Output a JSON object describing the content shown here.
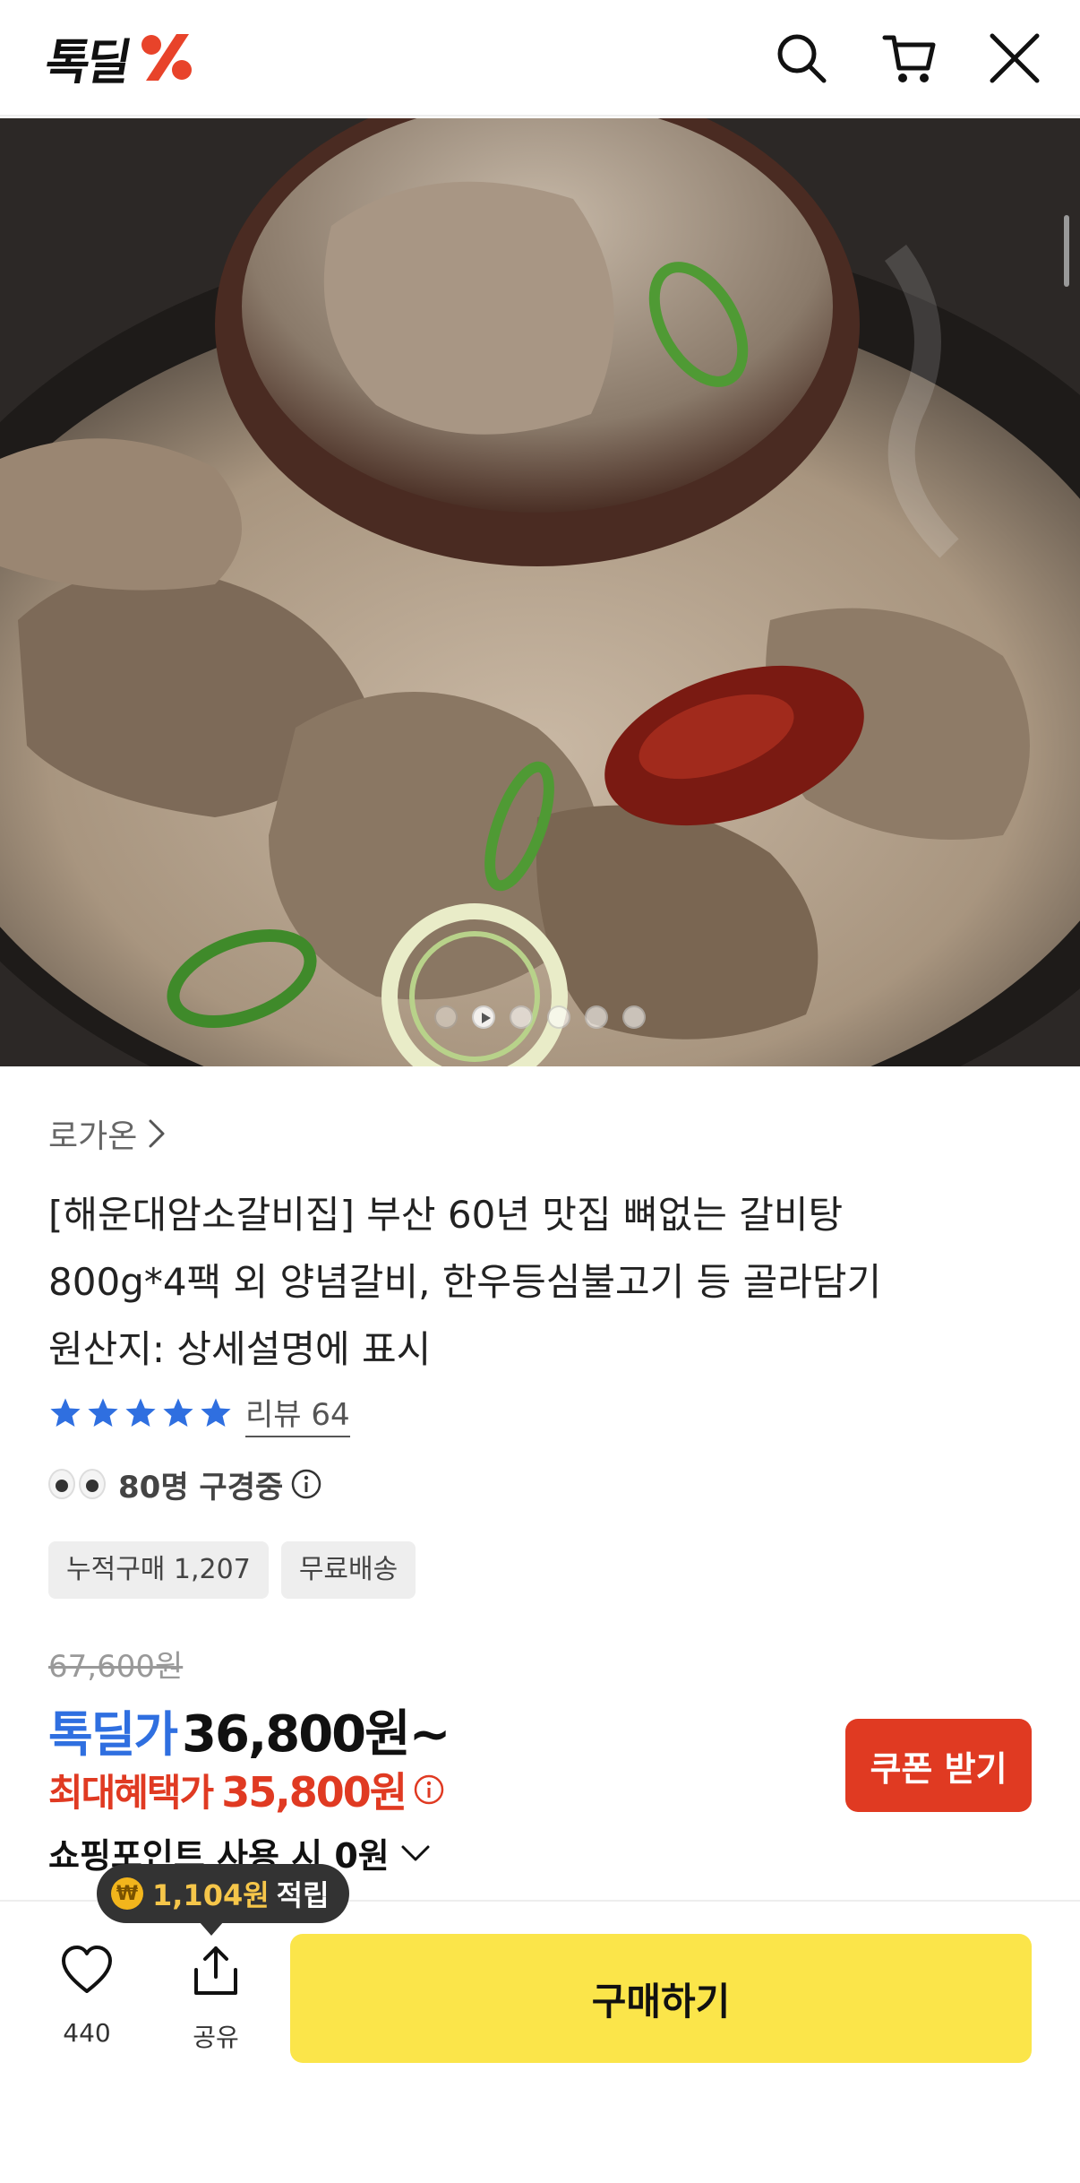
{
  "header": {
    "logo_text": "톡딜",
    "icons": [
      "search-icon",
      "cart-icon",
      "close-icon"
    ]
  },
  "hero": {
    "image_description_icon": "product-photo",
    "carousel_count": 6,
    "carousel_active": 1
  },
  "product": {
    "seller": "로가온",
    "title_lines": [
      "[해운대암소갈비집] 부산 60년 맛집 뼈없는 갈비탕",
      "800g*4팩 외 양념갈비, 한우등심불고기 등 골라담기",
      "원산지: 상세설명에 표시"
    ],
    "review_label": "리뷰 64",
    "rating_stars": 5,
    "viewers_text": "80명 구경중",
    "badges": [
      "누적구매 1,207",
      "무료배송"
    ],
    "original_price": "67,600원",
    "deal_label": "톡딜가",
    "deal_price": "36,800원~",
    "max_label": "최대혜택가",
    "max_price": "35,800원",
    "point_text": "쇼핑포인트 사용 시 0원",
    "coupon_button": "쿠폰 받기"
  },
  "bottom_bar": {
    "tooltip_amount": "1,104원",
    "tooltip_suffix": "적립",
    "wish_count": "440",
    "share_label": "공유",
    "buy_button": "구매하기"
  },
  "colors": {
    "accent_blue": "#2f6fe0",
    "accent_red": "#e03a22",
    "buy_yellow": "#fbe54a"
  }
}
